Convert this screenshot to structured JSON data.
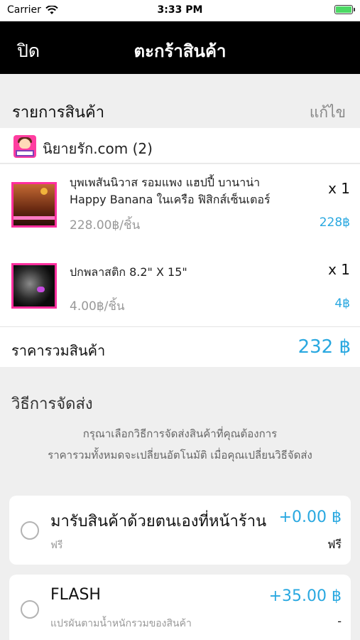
{
  "status_bar": {
    "carrier": "Carrier",
    "time": "3:33 PM"
  },
  "nav": {
    "close_label": "ปิด",
    "title": "ตะกร้าสินค้า"
  },
  "cart_section": {
    "title": "รายการสินค้า",
    "edit_label": "แก้ไข"
  },
  "shop": {
    "name": "นิยายรัก.com (2)"
  },
  "items": [
    {
      "name": "บุพเพสันนิวาส รอมแพง แฮปปี้ บานาน่า Happy Banana ในเครือ ฟิสิกส์เซ็นเตอร์",
      "quantity": "x 1",
      "unit_price": "228.00฿/ชิ้น",
      "total": "228฿"
    },
    {
      "name": "ปกพลาสติก 8.2\" X 15\"",
      "quantity": "x 1",
      "unit_price": "4.00฿/ชิ้น",
      "total": "4฿"
    }
  ],
  "summary": {
    "label": "ราคารวมสินค้า",
    "value": "232 ฿"
  },
  "shipping": {
    "title": "วิธีการจัดส่ง",
    "note_line1": "กรุณาเลือกวิธีการจัดส่งสินค้าที่คุณต้องการ",
    "note_line2": "ราคารวมทั้งหมดจะเปลี่ยนอัตโนมัติ เมื่อคุณเปลี่ยนวิธีจัดส่ง",
    "options": [
      {
        "title": "มารับสินค้าด้วยตนเองที่หน้าร้าน",
        "price": "+0.00 ฿",
        "subtitle": "ฟรี",
        "right_note": "ฟรี"
      },
      {
        "title": "FLASH",
        "price": "+35.00 ฿",
        "subtitle": "แปรผันตามน้ำหนักรวมของสินค้า",
        "right_note": "-"
      }
    ]
  },
  "colors": {
    "accent": "#29a8e0",
    "nav_bg": "#000000",
    "thumb_border": "#ff2f9e"
  }
}
